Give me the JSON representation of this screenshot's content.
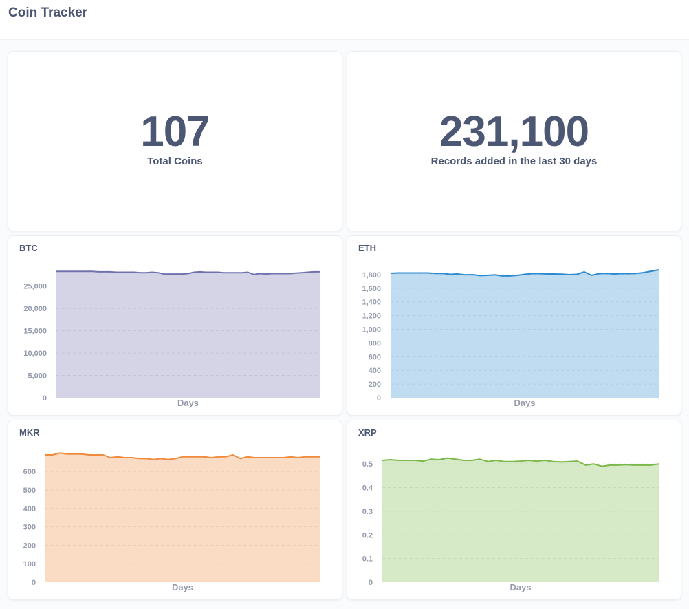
{
  "app": {
    "title": "Coin Tracker"
  },
  "scalars": [
    {
      "value": "107",
      "label": "Total Coins"
    },
    {
      "value": "231,100",
      "label": "Records added in the last 30 days"
    }
  ],
  "colors": {
    "btc": "#7172ad",
    "eth": "#2c8ad0",
    "mkr": "#f08a3c",
    "xrp": "#7bb84a"
  },
  "chart_data": [
    {
      "type": "area",
      "title": "BTC",
      "xlabel": "Days",
      "ylabel": "",
      "yticks": [
        0,
        5000,
        10000,
        15000,
        20000,
        25000
      ],
      "ytick_labels": [
        "0",
        "5,000",
        "10,000",
        "15,000",
        "20,000",
        "25,000"
      ],
      "ylim": [
        0,
        28800
      ],
      "series": [
        {
          "values": [
            28300,
            28300,
            28300,
            28300,
            28300,
            28300,
            28300,
            28200,
            28200,
            28200,
            28100,
            28100,
            28100,
            28100,
            28000,
            28000,
            28100,
            28000,
            27700,
            27700,
            27700,
            27700,
            27800,
            28100,
            28200,
            28100,
            28100,
            28100,
            28000,
            28000,
            28000,
            28000,
            28100,
            27600,
            27800,
            27700,
            27800,
            27800,
            27800,
            27800,
            27900,
            28000,
            28100,
            28200,
            28200
          ]
        }
      ]
    },
    {
      "type": "area",
      "title": "ETH",
      "xlabel": "Days",
      "ylabel": "",
      "yticks": [
        0,
        200,
        400,
        600,
        800,
        1000,
        1200,
        1400,
        1600,
        1800
      ],
      "ytick_labels": [
        "0",
        "200",
        "400",
        "600",
        "800",
        "1,000",
        "1,200",
        "1,400",
        "1,600",
        "1,800"
      ],
      "ylim": [
        0,
        1880
      ],
      "series": [
        {
          "values": [
            1820,
            1825,
            1825,
            1825,
            1825,
            1825,
            1818,
            1818,
            1805,
            1810,
            1798,
            1800,
            1785,
            1790,
            1798,
            1780,
            1780,
            1790,
            1805,
            1815,
            1815,
            1810,
            1810,
            1808,
            1800,
            1805,
            1840,
            1790,
            1815,
            1818,
            1810,
            1815,
            1815,
            1818,
            1830,
            1850,
            1870
          ]
        }
      ]
    },
    {
      "type": "area",
      "title": "MKR",
      "xlabel": "Days",
      "ylabel": "",
      "yticks": [
        0,
        100,
        200,
        300,
        400,
        500,
        600
      ],
      "ytick_labels": [
        "0",
        "100",
        "200",
        "300",
        "400",
        "500",
        "600"
      ],
      "ylim": [
        0,
        705
      ],
      "series": [
        {
          "values": [
            690,
            690,
            700,
            695,
            695,
            695,
            690,
            690,
            690,
            675,
            680,
            675,
            675,
            670,
            670,
            665,
            670,
            665,
            670,
            680,
            680,
            680,
            680,
            675,
            680,
            680,
            690,
            670,
            680,
            675,
            675,
            675,
            675,
            675,
            680,
            675,
            680,
            680,
            680
          ]
        }
      ]
    },
    {
      "type": "area",
      "title": "XRP",
      "xlabel": "Days",
      "ylabel": "",
      "yticks": [
        0,
        0.1,
        0.2,
        0.3,
        0.4,
        0.5
      ],
      "ytick_labels": [
        "0",
        "0.1",
        "0.2",
        "0.3",
        "0.4",
        "0.5"
      ],
      "ylim": [
        0,
        0.55
      ],
      "series": [
        {
          "values": [
            0.515,
            0.518,
            0.515,
            0.515,
            0.515,
            0.512,
            0.52,
            0.518,
            0.525,
            0.52,
            0.515,
            0.515,
            0.52,
            0.51,
            0.515,
            0.51,
            0.51,
            0.512,
            0.515,
            0.512,
            0.515,
            0.51,
            0.508,
            0.51,
            0.512,
            0.495,
            0.5,
            0.49,
            0.495,
            0.495,
            0.497,
            0.495,
            0.495,
            0.495,
            0.5
          ]
        }
      ]
    }
  ]
}
